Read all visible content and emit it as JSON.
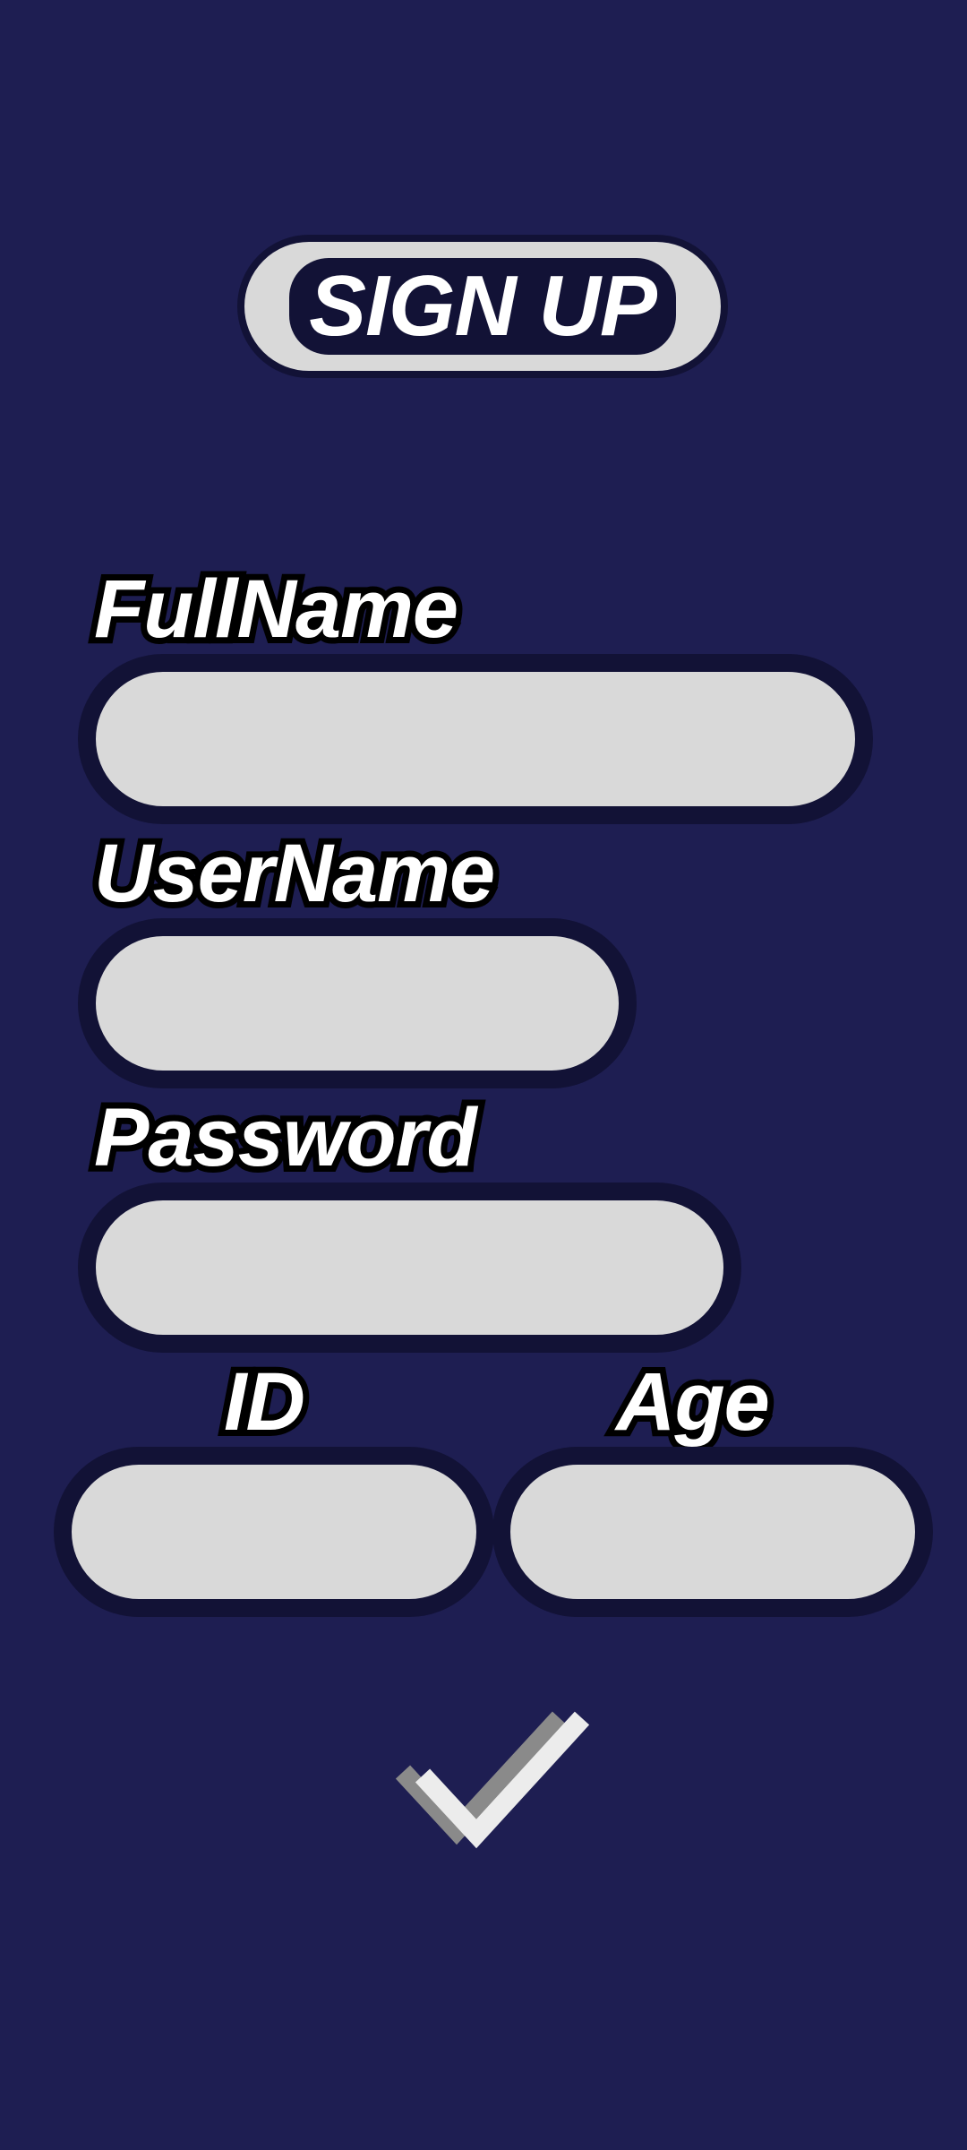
{
  "header": {
    "title": "SIGN UP"
  },
  "form": {
    "fullname_label": "FullName",
    "fullname_value": "",
    "username_label": "UserName",
    "username_value": "",
    "password_label": "Password",
    "password_value": "",
    "id_label": "ID",
    "id_value": "",
    "age_label": "Age",
    "age_value": ""
  },
  "actions": {
    "submit_icon": "checkmark-icon"
  },
  "colors": {
    "background": "#1e1e52",
    "field_fill": "#d9d9d9",
    "field_border": "#121236",
    "text": "#ffffff"
  }
}
